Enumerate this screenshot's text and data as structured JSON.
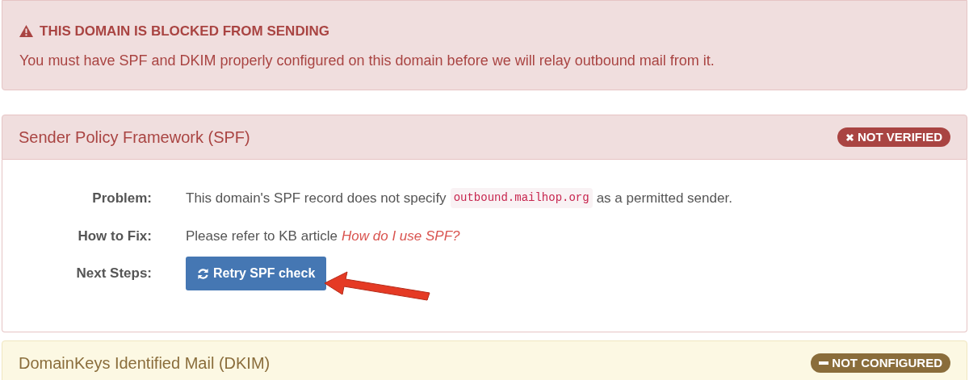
{
  "alert": {
    "title": "THIS DOMAIN IS BLOCKED FROM SENDING",
    "message": "You must have SPF and DKIM properly configured on this domain before we will relay outbound mail from it."
  },
  "panels": [
    {
      "title": "Sender Policy Framework (SPF)",
      "kind": "error",
      "badge": "NOT VERIFIED",
      "rows": [
        {
          "kind": "code",
          "label": "Problem:",
          "before": "This domain's SPF record does not specify",
          "code": "outbound.mailhop.org",
          "after": "as a permitted sender."
        },
        {
          "kind": "link",
          "label": "How to Fix:",
          "before": "Please refer to KB article",
          "link": "How do I use SPF?"
        },
        {
          "kind": "button",
          "label": "Next Steps:",
          "button": "Retry SPF check"
        }
      ]
    },
    {
      "title": "DomainKeys Identified Mail (DKIM)",
      "kind": "warning",
      "badge": "NOT CONFIGURED"
    }
  ]
}
